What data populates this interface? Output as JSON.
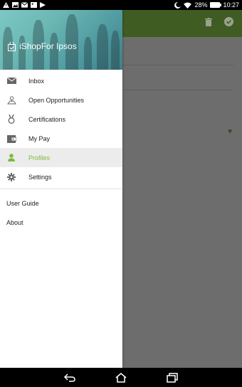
{
  "status": {
    "battery": "28%",
    "time": "10:27"
  },
  "drawer": {
    "brand": "iShopFor Ipsos",
    "items": [
      {
        "label": "Inbox",
        "icon": "mail-icon"
      },
      {
        "label": "Open Opportunities",
        "icon": "map-pin-icon"
      },
      {
        "label": "Certifications",
        "icon": "medal-icon"
      },
      {
        "label": "My Pay",
        "icon": "wallet-icon"
      },
      {
        "label": "Profiles",
        "icon": "person-icon",
        "active": true
      },
      {
        "label": "Settings",
        "icon": "gear-icon"
      }
    ],
    "secondary": [
      {
        "label": "User Guide"
      },
      {
        "label": "About"
      }
    ]
  },
  "colors": {
    "accent": "#7cbb3a",
    "appbar": "#3f5c22"
  }
}
